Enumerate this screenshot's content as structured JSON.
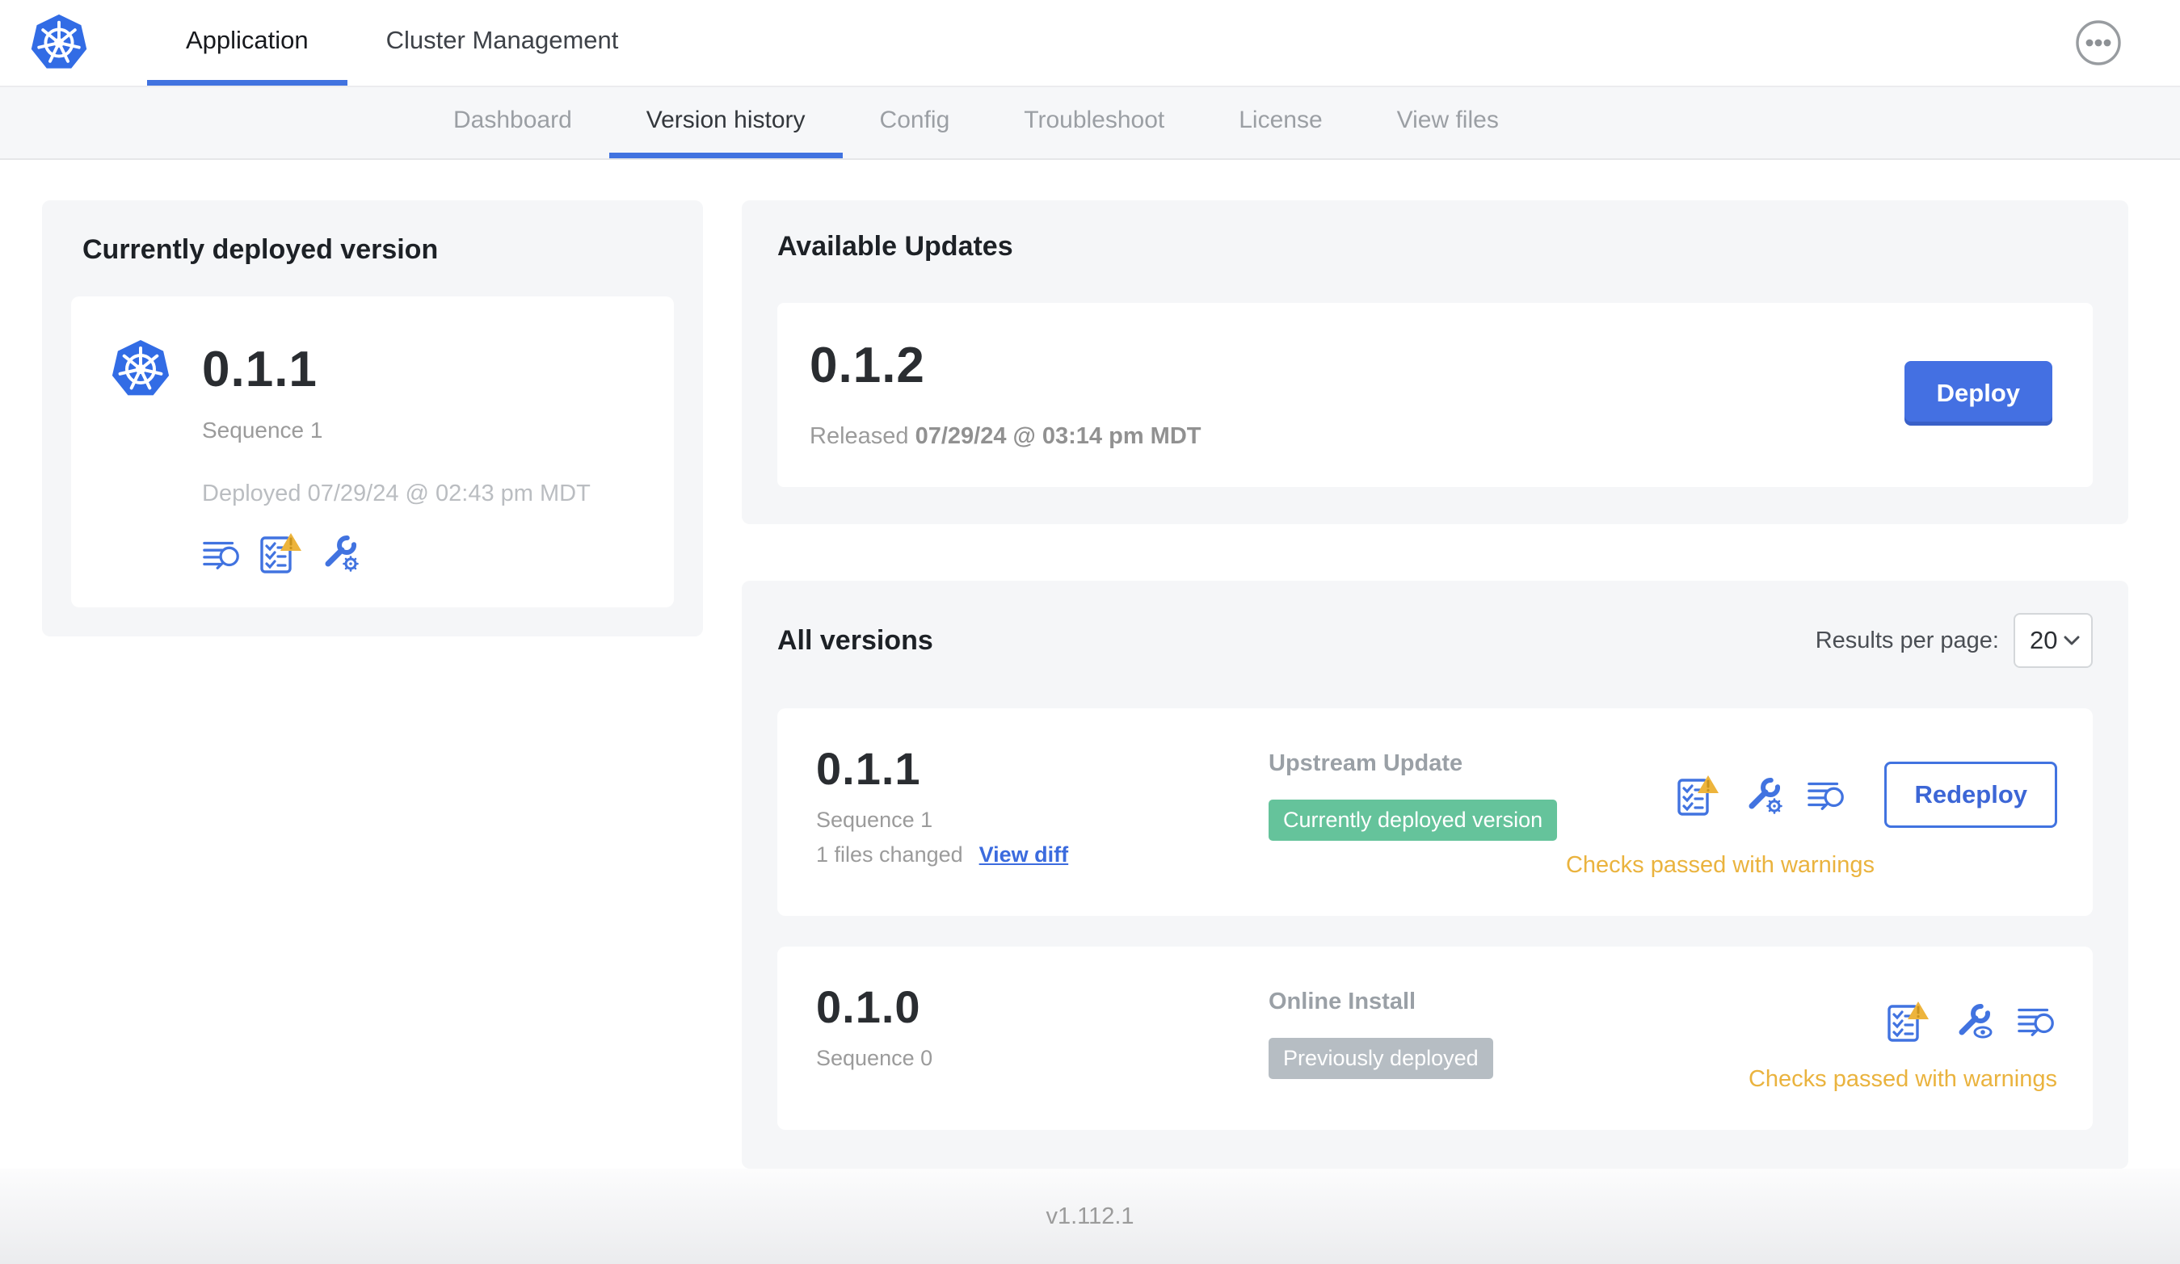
{
  "header": {
    "tabs": [
      {
        "label": "Application"
      },
      {
        "label": "Cluster Management"
      }
    ]
  },
  "subnav": {
    "items": [
      {
        "label": "Dashboard"
      },
      {
        "label": "Version history"
      },
      {
        "label": "Config"
      },
      {
        "label": "Troubleshoot"
      },
      {
        "label": "License"
      },
      {
        "label": "View files"
      }
    ]
  },
  "current_version_card": {
    "title": "Currently deployed version",
    "version": "0.1.1",
    "sequence": "Sequence 1",
    "deployed": "Deployed 07/29/24 @ 02:43 pm MDT",
    "icons": [
      "release-notes-icon",
      "preflight-checks-warning-icon",
      "config-icon"
    ]
  },
  "available_updates": {
    "title": "Available Updates",
    "version": "0.1.2",
    "released_label": "Released",
    "released_date": "07/29/24 @ 03:14 pm MDT",
    "deploy_label": "Deploy"
  },
  "all_versions": {
    "title": "All versions",
    "results_per_page_label": "Results per page:",
    "results_per_page_value": "20",
    "rows": [
      {
        "version": "0.1.1",
        "sequence": "Sequence 1",
        "files_changed": "1 files changed",
        "view_diff_label": "View diff",
        "source": "Upstream Update",
        "badge": "Currently deployed version",
        "badge_color": "#65c39b",
        "icons": [
          "preflight-checks-warning-icon",
          "config-gear-icon",
          "release-notes-icon"
        ],
        "action_label": "Redeploy",
        "status": "Checks passed with warnings"
      },
      {
        "version": "0.1.0",
        "sequence": "Sequence 0",
        "source": "Online Install",
        "badge": "Previously deployed",
        "badge_color": "#b6bdc3",
        "icons": [
          "preflight-checks-warning-icon",
          "config-view-icon",
          "release-notes-icon"
        ],
        "status": "Checks passed with warnings"
      }
    ]
  },
  "footer": {
    "app_version": "v1.112.1"
  },
  "colors": {
    "accent_blue": "#4173e0",
    "deploy_button": "#4470e2",
    "kubernetes_blue": "#326ce5",
    "badge_green": "#65c39b",
    "badge_gray": "#b6bdc3",
    "warning_amber": "#edb43c",
    "subnav_bg": "#f6f7f9",
    "card_bg": "#f5f6f8"
  }
}
